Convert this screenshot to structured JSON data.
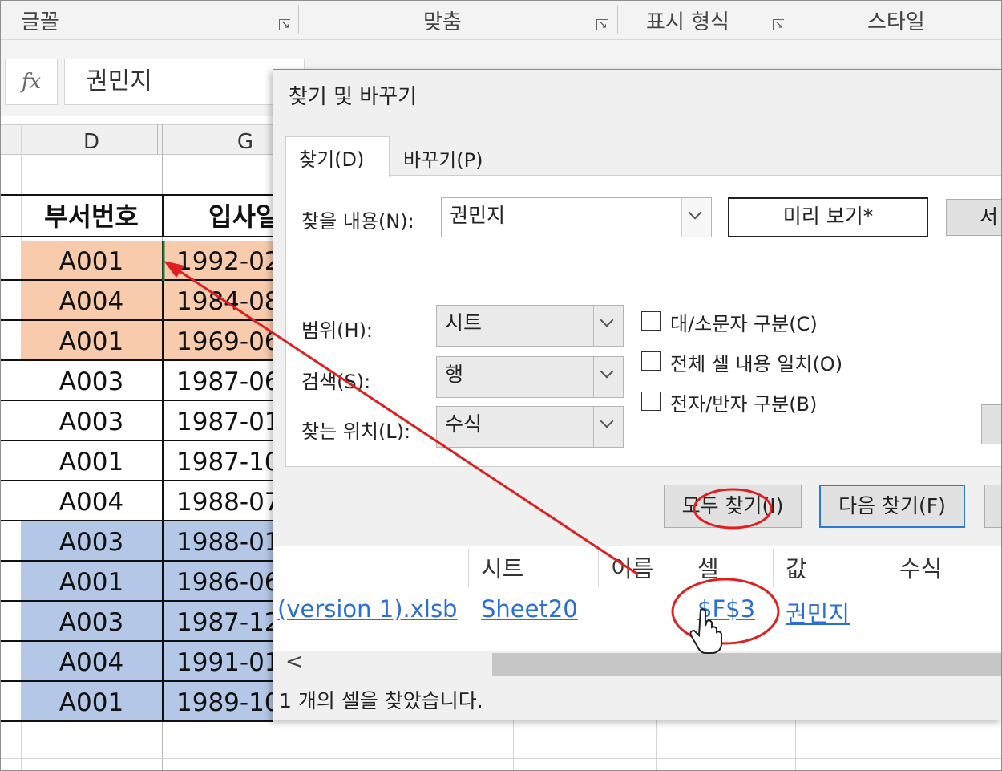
{
  "ribbon": {
    "groups": [
      "글꼴",
      "맞춤",
      "표시 형식",
      "스타일"
    ]
  },
  "formula_bar": {
    "fx_label": "fx",
    "value": "권민지"
  },
  "columns": [
    "D",
    "G"
  ],
  "sheet": {
    "header_row": [
      "부서번호",
      "입사일"
    ],
    "rows": [
      {
        "dept": "A001",
        "date": "1992-02",
        "fill": "orange"
      },
      {
        "dept": "A004",
        "date": "1984-08",
        "fill": "orange"
      },
      {
        "dept": "A001",
        "date": "1969-06",
        "fill": "orange"
      },
      {
        "dept": "A003",
        "date": "1987-06",
        "fill": "none"
      },
      {
        "dept": "A003",
        "date": "1987-01",
        "fill": "none"
      },
      {
        "dept": "A001",
        "date": "1987-10",
        "fill": "none"
      },
      {
        "dept": "A004",
        "date": "1988-07",
        "fill": "none"
      },
      {
        "dept": "A003",
        "date": "1988-01",
        "fill": "blue"
      },
      {
        "dept": "A001",
        "date": "1986-06",
        "fill": "blue"
      },
      {
        "dept": "A003",
        "date": "1987-12",
        "fill": "blue"
      },
      {
        "dept": "A004",
        "date": "1991-01",
        "fill": "blue"
      },
      {
        "dept": "A001",
        "date": "1989-10",
        "fill": "blue"
      }
    ],
    "colors": {
      "orange": "#f8cbad",
      "blue": "#b4c7e7",
      "none": "#ffffff"
    }
  },
  "dialog": {
    "title": "찾기 및 바꾸기",
    "tabs": [
      "찾기(D)",
      "바꾸기(P)"
    ],
    "find_label": "찾을 내용(N):",
    "find_value": "권민지",
    "preview_button": "미리 보기*",
    "cut_button": "서",
    "scope_label": "범위(H):",
    "scope_value": "시트",
    "search_label": "검색(S):",
    "search_value": "행",
    "lookin_label": "찾는 위치(L):",
    "lookin_value": "수식",
    "checkboxes": [
      "대/소문자 구분(C)",
      "전체 셀 내용 일치(O)",
      "전자/반자 구분(B)"
    ],
    "find_all_button": "모두 찾기(I)",
    "find_next_button": "다음 찾기(F)",
    "results_headers": [
      "시트",
      "이름",
      "셀",
      "값",
      "수식"
    ],
    "result": {
      "book": "(version 1).xlsb",
      "sheet": "Sheet20",
      "cell": "$F$3",
      "value": "권민지"
    },
    "scroll_left": "<",
    "status": "1 개의 셀을 찾았습니다."
  },
  "annotation_color": "#e02020"
}
